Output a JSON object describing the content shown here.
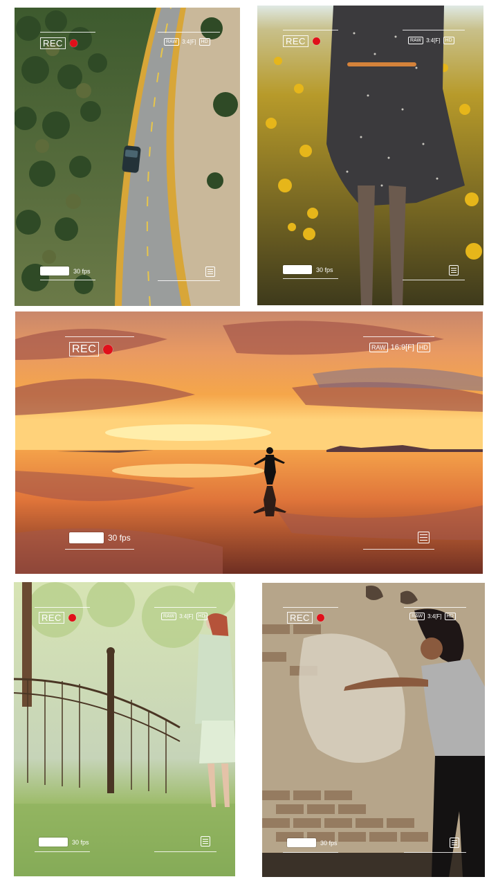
{
  "overlay": {
    "rec_label": "REC",
    "raw_label": "RAW",
    "hd_label": "HD",
    "fps_label": "30 fps",
    "aspect_portrait": "3:4[F]",
    "aspect_landscape": "16:9[F]",
    "rec_dot_color": "#e0101a",
    "menu_icon": "menu-list-icon"
  },
  "tiles": [
    {
      "scene": "aerial road with car through forest",
      "aspect": "3:4[F]"
    },
    {
      "scene": "woman in polka-dot dress in yellow flower field",
      "aspect": "3:4[F]"
    },
    {
      "scene": "person on salt flat mirror at sunset",
      "aspect": "16:9[F]"
    },
    {
      "scene": "woman in light dress near iron railing in park",
      "aspect": "3:4[F]"
    },
    {
      "scene": "dancer in front of weathered brick wall",
      "aspect": "3:4[F]"
    }
  ]
}
